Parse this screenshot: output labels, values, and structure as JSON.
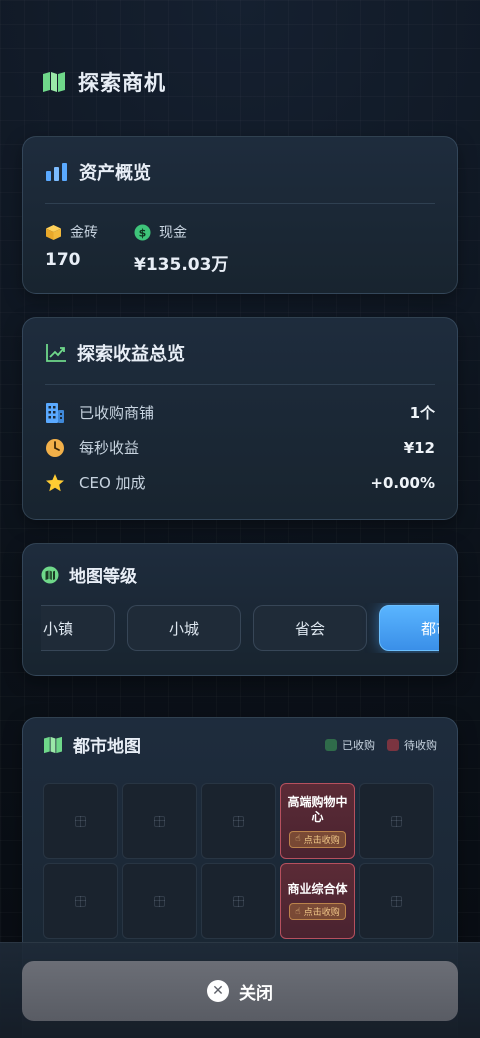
{
  "page": {
    "title": "探索商机"
  },
  "assets": {
    "title": "资产概览",
    "gold": {
      "label": "金砖",
      "value": "170"
    },
    "cash": {
      "label": "现金",
      "value": "¥135.03万"
    }
  },
  "earnings": {
    "title": "探索收益总览",
    "rows": [
      {
        "label": "已收购商铺",
        "value": "1个"
      },
      {
        "label": "每秒收益",
        "value": "¥12"
      },
      {
        "label": "CEO 加成",
        "value": "+0.00%"
      }
    ]
  },
  "map_level": {
    "title": "地图等级",
    "levels": [
      "小镇",
      "小城",
      "省会",
      "都市"
    ],
    "active": "都市"
  },
  "city_map": {
    "title": "都市地图",
    "legend": {
      "acquired": "已收购",
      "pending": "待收购"
    },
    "shops": [
      {
        "name": "高端购物中心",
        "tag": "点击收购"
      },
      {
        "name": "商业综合体",
        "tag": "点击收购"
      }
    ]
  },
  "footer": {
    "close_label": "关闭"
  },
  "colors": {
    "accent_blue": "#4aa8ff",
    "acquired": "#2f6b4a",
    "pending": "#7a3440",
    "gold": "#f2b93b",
    "green": "#3ec47a"
  }
}
